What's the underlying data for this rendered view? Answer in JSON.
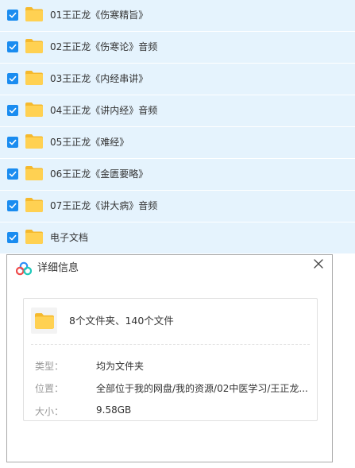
{
  "file_list": {
    "items": [
      {
        "name": "01王正龙《伤寒精旨》",
        "checked": true
      },
      {
        "name": "02王正龙《伤寒论》音频",
        "checked": true
      },
      {
        "name": "03王正龙《内经串讲》",
        "checked": true
      },
      {
        "name": "04王正龙《讲内经》音频",
        "checked": true
      },
      {
        "name": "05王正龙《难经》",
        "checked": true
      },
      {
        "name": "06王正龙《金匮要略》",
        "checked": true
      },
      {
        "name": "07王正龙《讲大病》音频",
        "checked": true
      },
      {
        "name": "电子文档",
        "checked": true
      }
    ]
  },
  "details_dialog": {
    "title": "详细信息",
    "summary": "8个文件夹、140个文件",
    "properties": {
      "type_label": "类型：",
      "type_value": "均为文件夹",
      "location_label": "位置：",
      "location_value": "全部位于我的网盘/我的资源/02中医学习/王正龙...",
      "size_label": "大小：",
      "size_value": "9.58GB"
    }
  },
  "colors": {
    "row_selected_bg": "#e5f3fd",
    "checkbox": "#1a8cf0",
    "folder": "#ffd152",
    "folder_tab": "#f5b92d"
  },
  "icons": {
    "checkbox": "checkmark-icon",
    "folder": "folder-icon",
    "logo": "cloud-logo-icon",
    "close": "close-icon"
  }
}
